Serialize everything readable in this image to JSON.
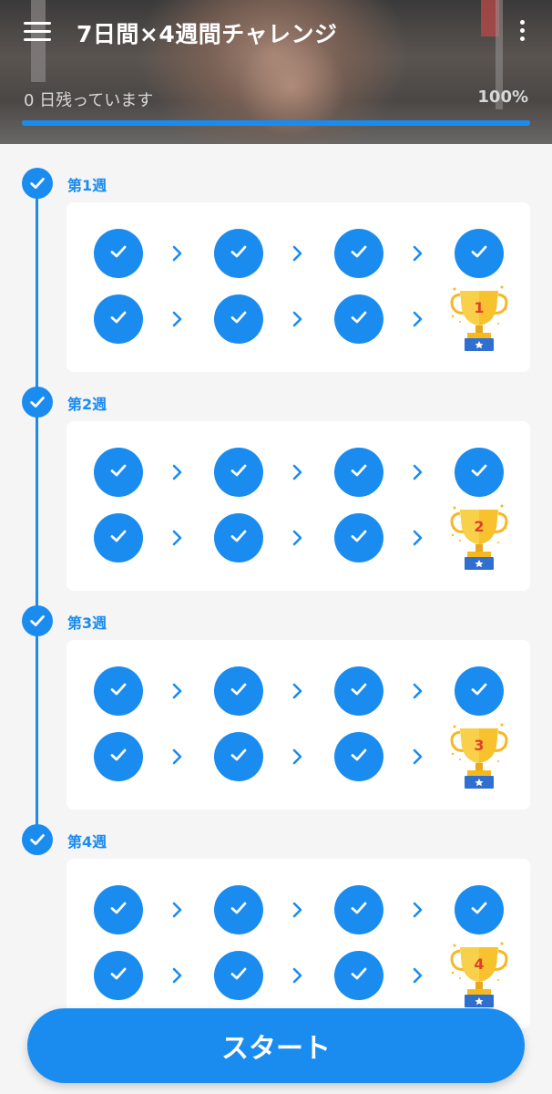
{
  "header": {
    "title": "7日間×4週間チャレンジ",
    "remaining": "0 日残っています",
    "percent": "100%",
    "progress": 1.0
  },
  "weeks": [
    {
      "label": "第1週",
      "trophy_number": "1"
    },
    {
      "label": "第2週",
      "trophy_number": "2"
    },
    {
      "label": "第3週",
      "trophy_number": "3"
    },
    {
      "label": "第4週",
      "trophy_number": "4"
    }
  ],
  "start_button": "スタート",
  "colors": {
    "accent": "#1a8cf0",
    "trophy": "#f5b820"
  },
  "icons": {
    "menu": "menu-icon",
    "more": "more-vert-icon",
    "check": "check-icon",
    "arrow": "chevron-right-icon",
    "trophy": "trophy-icon"
  }
}
